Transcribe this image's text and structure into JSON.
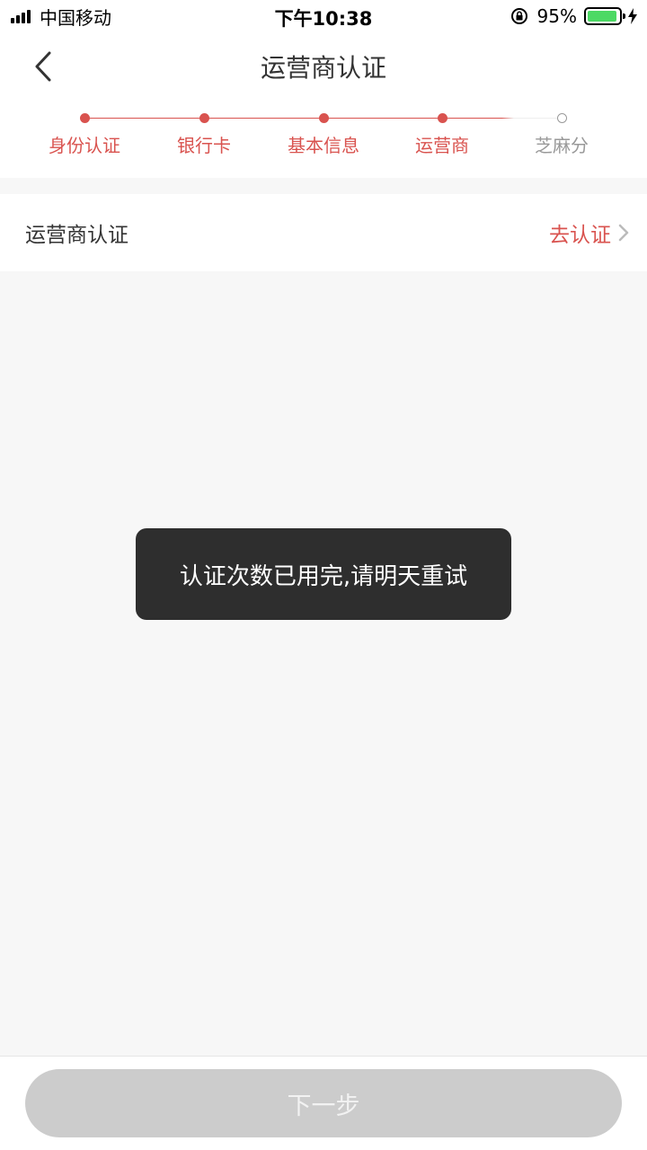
{
  "status_bar": {
    "carrier": "中国移动",
    "time": "下午10:38",
    "battery_percent": "95%",
    "battery_level": 0.95,
    "icons": [
      "signal-icon",
      "rotation-lock-icon",
      "battery-icon",
      "charging-bolt-icon"
    ]
  },
  "header": {
    "title": "运营商认证",
    "back_icon": "chevron-left-icon"
  },
  "steps": {
    "items": [
      {
        "label": "身份认证",
        "done": true
      },
      {
        "label": "银行卡",
        "done": true
      },
      {
        "label": "基本信息",
        "done": true
      },
      {
        "label": "运营商",
        "done": true
      },
      {
        "label": "芝麻分",
        "done": false
      }
    ]
  },
  "auth_row": {
    "label": "运营商认证",
    "action_label": "去认证",
    "action_icon": "chevron-right-icon"
  },
  "toast": {
    "message": "认证次数已用完,请明天重试"
  },
  "footer": {
    "next_label": "下一步"
  },
  "colors": {
    "accent": "#d9534f",
    "inactive": "#999999",
    "toast_bg": "#2e2e2e",
    "button_disabled": "#cccccc"
  }
}
